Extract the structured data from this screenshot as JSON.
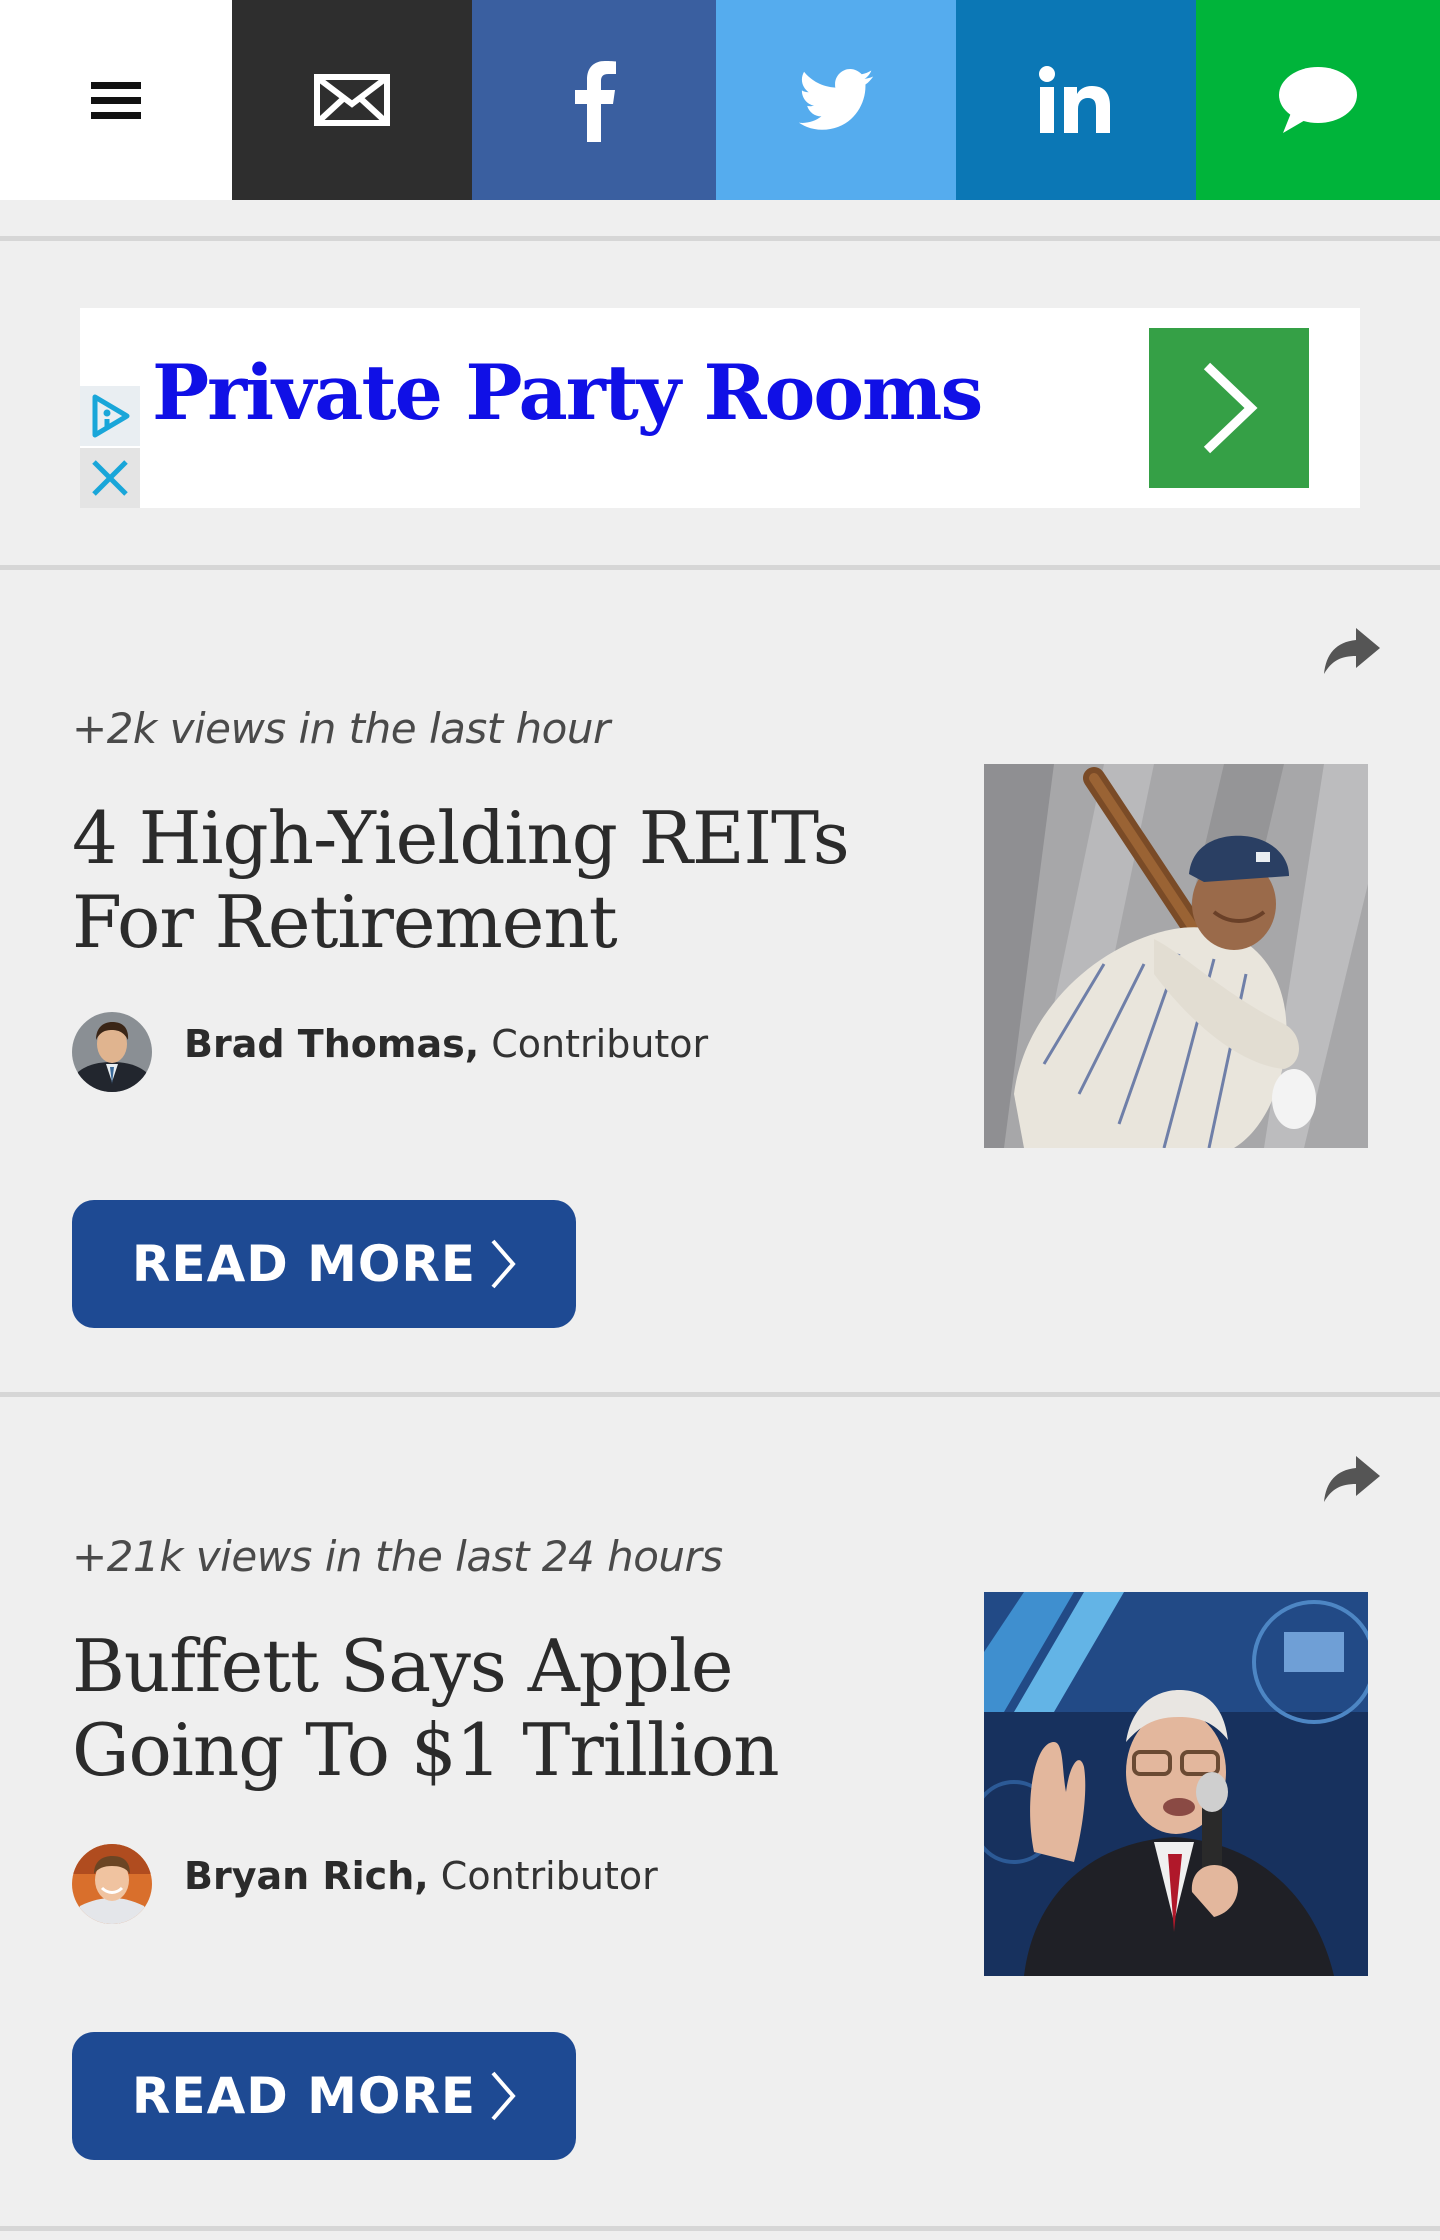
{
  "topbar": {
    "items": [
      {
        "name": "menu",
        "icon": "hamburger-menu-icon",
        "bg": "#ffffff"
      },
      {
        "name": "email",
        "icon": "envelope-icon",
        "bg": "#2e2e2e"
      },
      {
        "name": "facebook",
        "icon": "facebook-icon",
        "bg": "#3a5fa0"
      },
      {
        "name": "twitter",
        "icon": "twitter-bird-icon",
        "bg": "#55acee"
      },
      {
        "name": "linkedin",
        "icon": "linkedin-icon",
        "bg": "#0b77b5"
      },
      {
        "name": "sms",
        "icon": "chat-bubble-icon",
        "bg": "#00b43a"
      }
    ]
  },
  "ad": {
    "headline": "Private Party Rooms",
    "headline_color": "#1010e6",
    "cta_color": "#35a046"
  },
  "articles": [
    {
      "views": "+2k views in the last hour",
      "title": "4 High-Yielding REITs For Retirement",
      "author": "Brad Thomas,",
      "role": "Contributor",
      "button": "READ MORE"
    },
    {
      "views": "+21k views in the last 24 hours",
      "title": "Buffett Says Apple Going To $1 Trillion",
      "author": "Bryan Rich,",
      "role": "Contributor",
      "button": "READ MORE"
    }
  ],
  "colors": {
    "button": "#1e4a93",
    "background": "#efefef"
  }
}
